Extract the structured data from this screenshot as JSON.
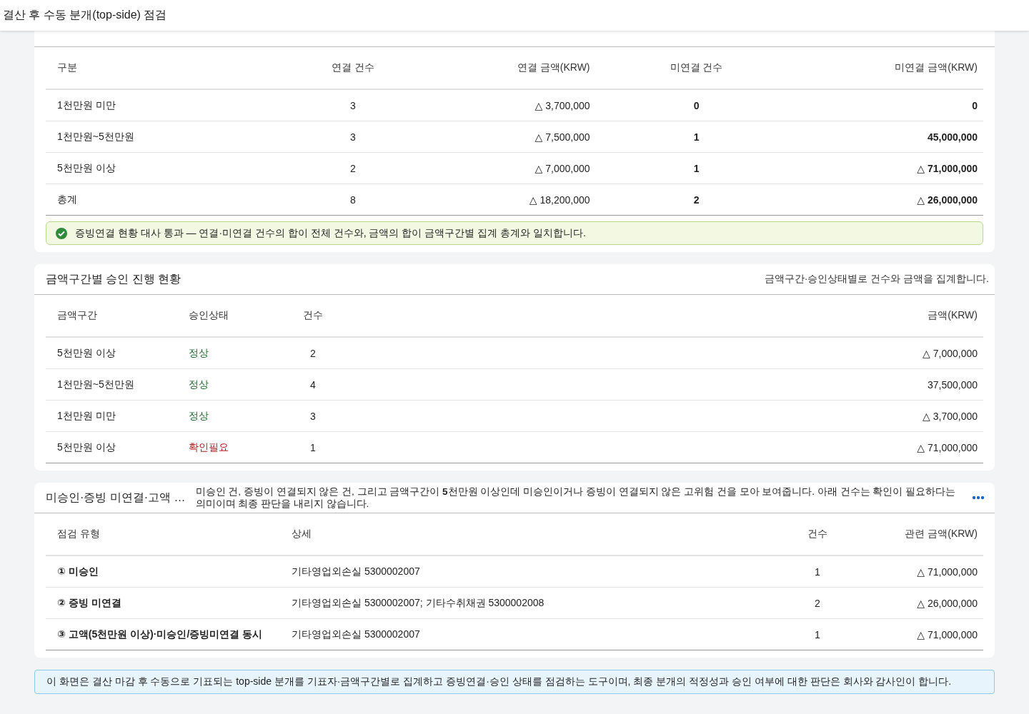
{
  "header": {
    "title": "결산 후 수동 분개(top-side) 점검"
  },
  "linkage": {
    "columns": [
      "구분",
      "연결 건수",
      "연결 금액(KRW)",
      "미연결 건수",
      "미연결 금액(KRW)"
    ],
    "rows": [
      [
        "1천만원 미만",
        "3",
        "△ 3,700,000",
        "0",
        "0"
      ],
      [
        "1천만원~5천만원",
        "3",
        "△ 7,500,000",
        "1",
        "45,000,000"
      ],
      [
        "5천만원 이상",
        "2",
        "△ 7,000,000",
        "1",
        "△ 71,000,000"
      ],
      [
        "총계",
        "8",
        "△ 18,200,000",
        "2",
        "△ 26,000,000"
      ]
    ],
    "check": {
      "passed": true,
      "text": "증빙연결 현황 대사 통과 — 연결·미연결 건수의 합이 전체 건수와, 금액의 합이 금액구간별 집계 총계와 일치합니다."
    }
  },
  "approval": {
    "title": "금액구간별 승인 진행 현황",
    "description": "금액구간·승인상태별로 건수와 금액을 집계합니다.",
    "columns": [
      "금액구간",
      "승인상태",
      "건수",
      "금액(KRW)"
    ],
    "rows": [
      {
        "band": "5천만원 이상",
        "status": "정상",
        "kind": "normal",
        "count": "2",
        "amount": "△ 7,000,000"
      },
      {
        "band": "1천만원~5천만원",
        "status": "정상",
        "kind": "normal",
        "count": "4",
        "amount": "37,500,000"
      },
      {
        "band": "1천만원 미만",
        "status": "정상",
        "kind": "normal",
        "count": "3",
        "amount": "△ 3,700,000"
      },
      {
        "band": "5천만원 이상",
        "status": "확인필요",
        "kind": "review",
        "count": "1",
        "amount": "△ 71,000,000"
      }
    ]
  },
  "exceptions": {
    "title": "미승인·증빙 미연결·고액 …",
    "description": "미승인 건, 증빙이 연결되지 않은 건, 그리고 금액구간이 **5**천만원 이상인데 미승인이거나 증빙이 연결되지 않은 고위험 건을 모아 보여줍니다. 아래 건수는 확인이 필요하다는 의미이며 최종 판단을 내리지 않습니다.",
    "columns": [
      "점검 유형",
      "상세",
      "건수",
      "관련 금액(KRW)"
    ],
    "rows": [
      [
        "① 미승인",
        "기타영업외손실 5300002007",
        "1",
        "△ 71,000,000"
      ],
      [
        "② 증빙 미연결",
        "기타영업외손실 5300002007; 기타수취채권 5300002008",
        "2",
        "△ 26,000,000"
      ],
      [
        "③ 고액(5천만원 이상)·미승인/증빙미연결 동시",
        "기타영업외손실 5300002007",
        "1",
        "△ 71,000,000"
      ]
    ]
  },
  "footer_note": "이 화면은 결산 마감 후 수동으로 기표되는 top-side 분개를 기표자·금액구간별로 집계하고 증빙연결·승인 상태를 점검하는 도구이며, 최종 분개의 적정성과 승인 여부에 대한 판단은 회사와 감사인이 합니다."
}
